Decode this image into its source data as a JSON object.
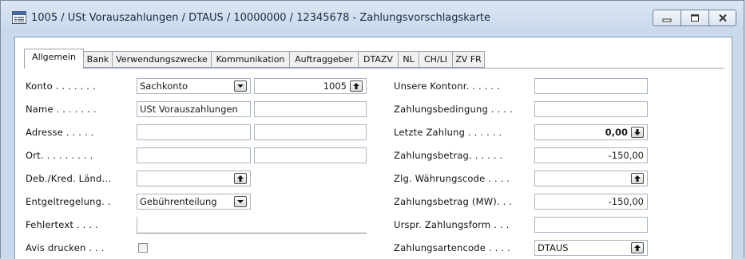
{
  "window": {
    "title": "1005 / USt Vorauszahlungen / DTAUS / 10000000 / 12345678 - Zahlungsvorschlagskarte",
    "icons": {
      "app": "card-window-icon",
      "minimize": "minimize-icon",
      "maximize": "maximize-icon",
      "close": "close-icon"
    }
  },
  "tabs": [
    {
      "label": "Allgemein",
      "active": true
    },
    {
      "label": "Bank"
    },
    {
      "label": "Verwendungszwecke"
    },
    {
      "label": "Kommunikation"
    },
    {
      "label": "Auftraggeber"
    },
    {
      "label": "DTAZV"
    },
    {
      "label": "NL"
    },
    {
      "label": "CH/LI"
    },
    {
      "label": "ZV FR"
    }
  ],
  "left": {
    "konto": {
      "label": "Konto . . . . . . .",
      "type_value": "Sachkonto",
      "number_value": "1005"
    },
    "name": {
      "label": "Name . . . . . . .",
      "value": "USt Vorauszahlungen",
      "value2": ""
    },
    "adresse": {
      "label": "Adresse . . . . .",
      "value": "",
      "value2": ""
    },
    "ort": {
      "label": "Ort. . . . . . . . .",
      "value": "",
      "value2": ""
    },
    "land": {
      "label": "Deb./Kred. Länd...",
      "value": ""
    },
    "entgelt": {
      "label": "Entgeltregelung. .",
      "value": "Gebührenteilung"
    },
    "fehlertext": {
      "label": "Fehlertext . . . .",
      "value": ""
    },
    "avis": {
      "label": "Avis drucken . . .",
      "checked": false
    }
  },
  "right": {
    "kontonr": {
      "label": "Unsere Kontonr. . . . . .",
      "value": ""
    },
    "zahlungsbedingung": {
      "label": "Zahlungsbedingung . . . .",
      "value": ""
    },
    "letzte_zahlung": {
      "label": "Letzte Zahlung . . . . . .",
      "value": "0,00"
    },
    "zahlungsbetrag": {
      "label": "Zahlungsbetrag. . . . . .",
      "value": "-150,00"
    },
    "waehrung": {
      "label": "Zlg. Währungscode . . . .",
      "value": ""
    },
    "zahlungsbetrag_mw": {
      "label": "Zahlungsbetrag (MW). . .",
      "value": "-150,00"
    },
    "urspr_form": {
      "label": "Urspr. Zahlungsform . . .",
      "value": ""
    },
    "zahlungsartencode": {
      "label": "Zahlungsartencode . . . .",
      "value": "DTAUS"
    }
  }
}
